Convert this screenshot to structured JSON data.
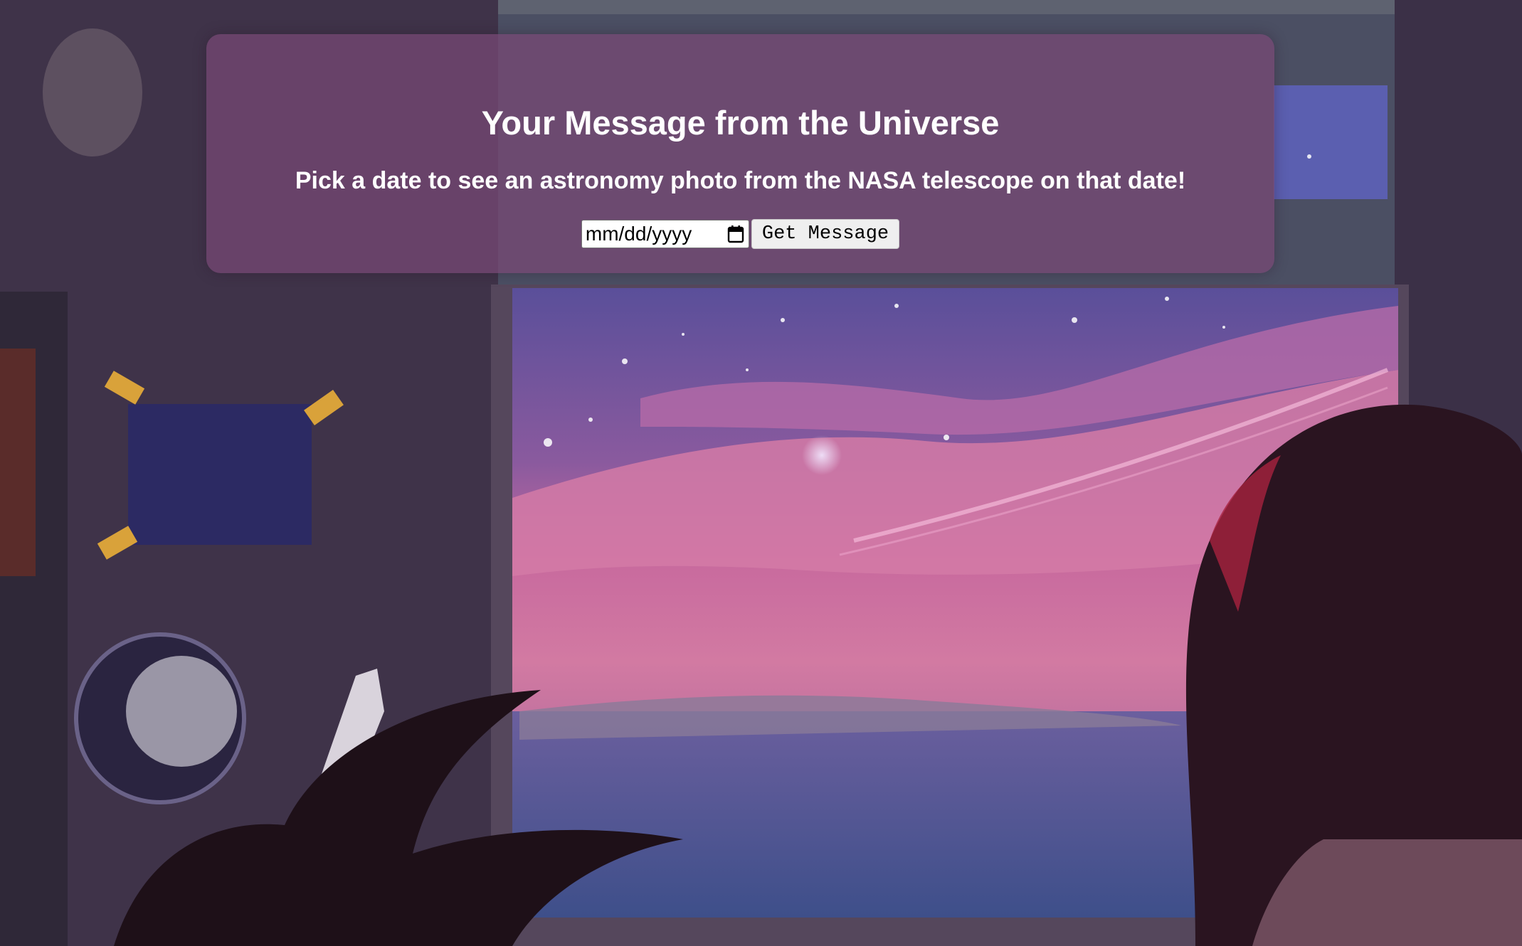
{
  "header": {
    "title": "Your Message from the Universe",
    "subtitle": "Pick a date to see an astronomy photo from the NASA telescope on that date!"
  },
  "form": {
    "date_placeholder": "mm/dd/yyyy",
    "date_icon": "calendar-icon",
    "submit_label": "Get Message"
  },
  "colors": {
    "card_background": "#7a4a78",
    "text": "#ffffff",
    "button_background": "#efefef"
  }
}
